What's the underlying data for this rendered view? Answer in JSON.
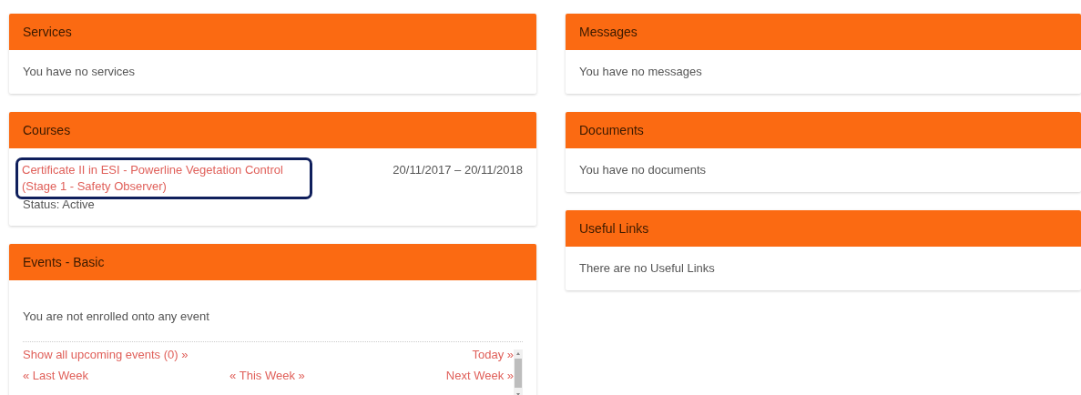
{
  "columns": [
    {
      "panels": [
        {
          "kind": "text",
          "title": "Services",
          "text": "You have no services"
        },
        {
          "kind": "courses",
          "title": "Courses",
          "courses": [
            {
              "name": "Certificate II in ESI - Powerline Vegetation Control (Stage 1 - Safety Observer)",
              "dates": "20/11/2017 – 20/11/2018",
              "status": "Status: Active",
              "highlighted": true
            }
          ]
        },
        {
          "kind": "events",
          "title": "Events - Basic",
          "text": "You are not enrolled onto any event",
          "links": [
            [
              "Show all upcoming events (0) »",
              "Today »"
            ],
            [
              "« Last Week",
              "« This Week »",
              "Next Week »"
            ]
          ]
        }
      ]
    },
    {
      "panels": [
        {
          "kind": "text",
          "title": "Messages",
          "text": "You have no messages"
        },
        {
          "kind": "text",
          "title": "Documents",
          "text": "You have no documents"
        },
        {
          "kind": "text",
          "title": "Useful Links",
          "text": "There are no Useful Links"
        }
      ]
    }
  ]
}
